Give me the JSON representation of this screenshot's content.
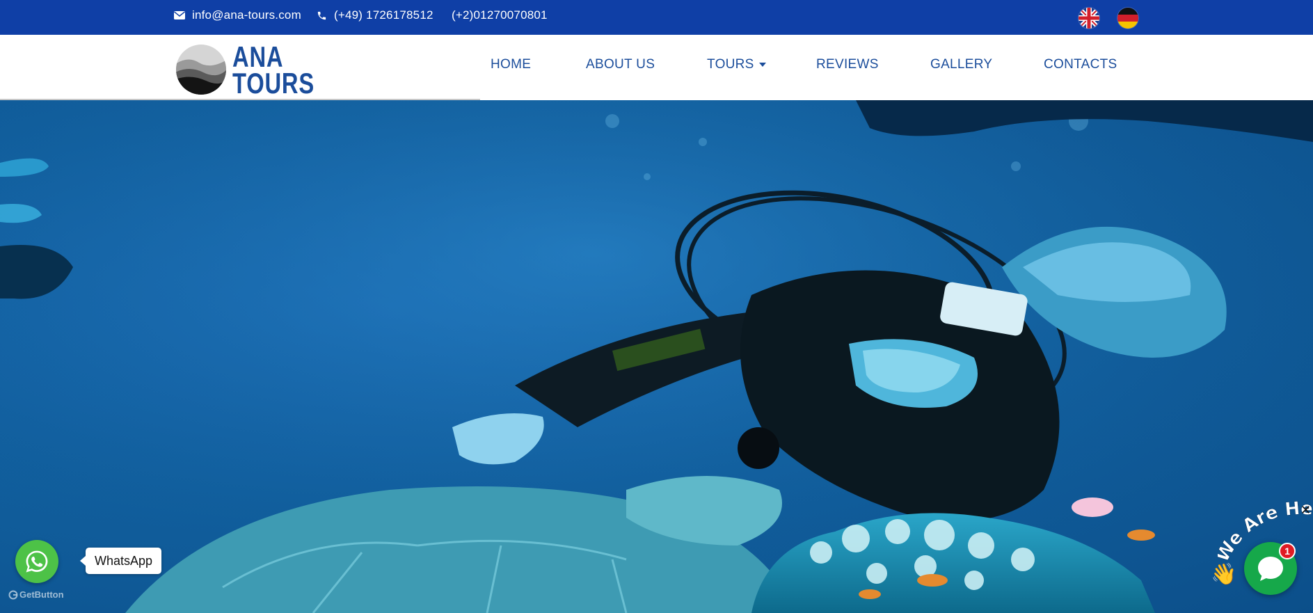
{
  "topbar": {
    "email": "info@ana-tours.com",
    "phone_de": "(+49) 1726178512",
    "phone_eg": "(+2)01270070801",
    "email_icon": "envelope-icon",
    "phone_icon": "phone-icon",
    "languages": [
      "English",
      "Deutsch"
    ]
  },
  "logo": {
    "line1": "ANA",
    "line2": "TOURS"
  },
  "nav": {
    "items": [
      {
        "label": "HOME"
      },
      {
        "label": "ABOUT US"
      },
      {
        "label": "TOURS",
        "has_dropdown": true
      },
      {
        "label": "REVIEWS"
      },
      {
        "label": "GALLERY"
      },
      {
        "label": "CONTACTS"
      }
    ]
  },
  "whatsapp": {
    "label": "WhatsApp",
    "powered_by": "GetButton",
    "color": "#4dc247"
  },
  "chat": {
    "banner": "We Are Here!",
    "badge_count": "1",
    "color": "#16a84a"
  },
  "colors": {
    "topbar": "#0f3fa6",
    "nav_text": "#1b4d9b",
    "hero_water": "#11609f"
  }
}
